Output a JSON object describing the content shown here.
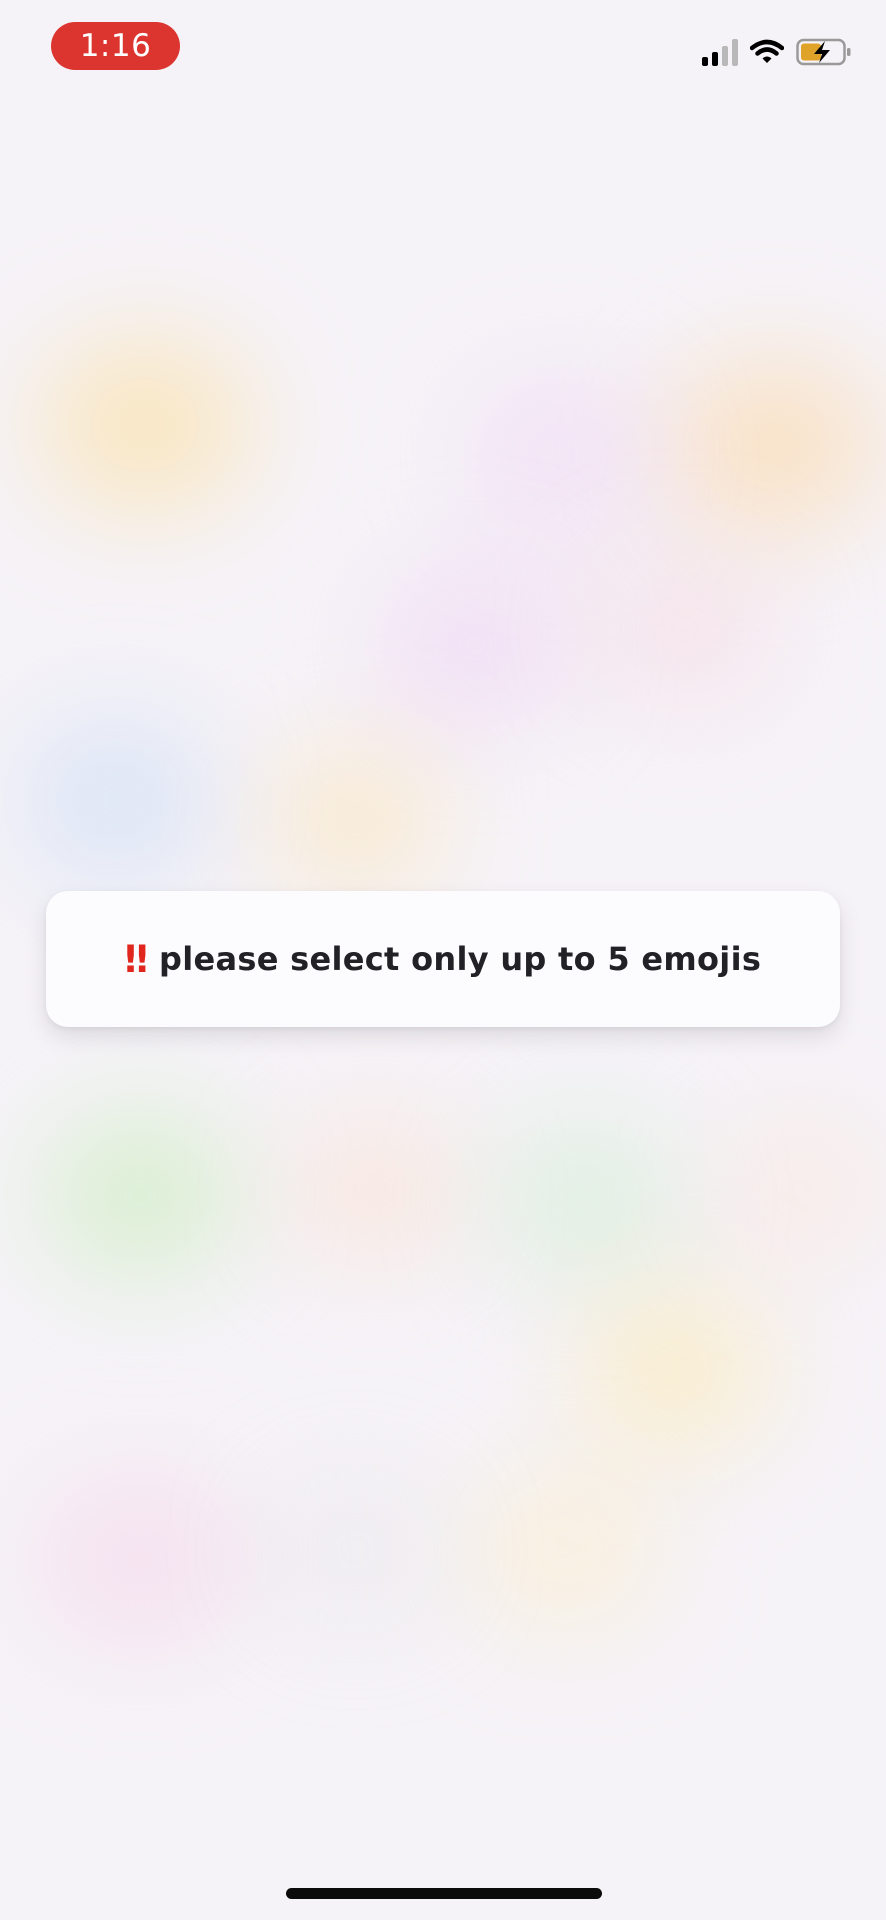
{
  "status_bar": {
    "time": "1:16",
    "icons": [
      "signal-icon",
      "wifi-icon",
      "battery-charging-icon"
    ]
  },
  "toast": {
    "icon": "‼",
    "message": "please select only up to 5 emojis"
  },
  "colors": {
    "time_pill": "#dc3530",
    "toast_icon": "#e0261d",
    "battery_fill": "#e0a32a"
  }
}
